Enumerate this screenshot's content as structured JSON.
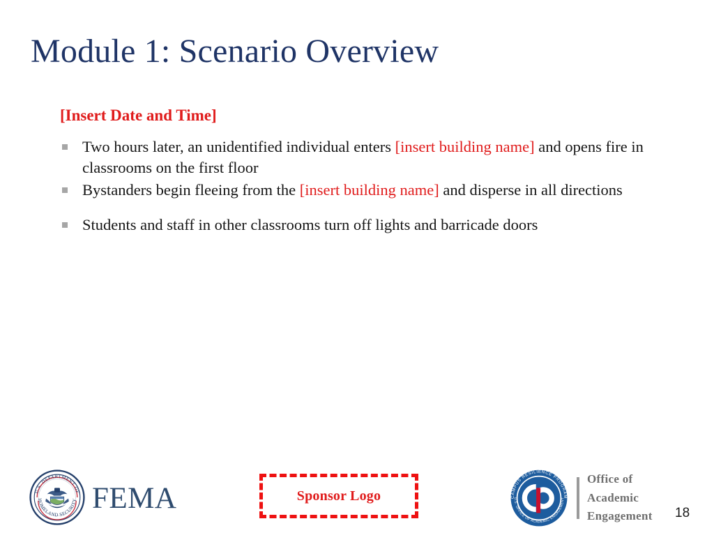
{
  "slide": {
    "title": "Module 1: Scenario Overview",
    "page_number": "18",
    "date_heading": "[Insert Date and Time]",
    "bullets": [
      {
        "parts": [
          {
            "text": "Two hours later, an unidentified individual enters ",
            "color": "black"
          },
          {
            "text": "[insert building name]",
            "color": "red"
          },
          {
            "text": " and opens fire in classrooms on the first floor",
            "color": "black"
          }
        ]
      },
      {
        "parts": [
          {
            "text": "Bystanders begin fleeing from the ",
            "color": "black"
          },
          {
            "text": "[insert building name]",
            "color": "red"
          },
          {
            "text": " and disperse in all directions",
            "color": "black"
          }
        ]
      },
      {
        "spaced": true,
        "parts": [
          {
            "text": "Students and staff in other classrooms turn off lights and barricade doors",
            "color": "black"
          }
        ]
      }
    ]
  },
  "footer": {
    "fema": {
      "seal_icon": "dhs-seal-icon",
      "seal_text_top": "U.S. DEPARTMENT OF",
      "seal_text_bottom": "HOMELAND SECURITY",
      "wordmark": "FEMA"
    },
    "sponsor": {
      "label": "Sponsor Logo"
    },
    "crp": {
      "seal_icon": "campus-resilience-program-seal-icon",
      "seal_monogram": "cp",
      "seal_text_top": "CAMPUS RESILIENCE PROGRAM",
      "seal_text_bottom": "U.S. OFFICE OF ACADEMIC ENGAGEMENT",
      "line1": "Office of",
      "line2": "Academic",
      "line3": "Engagement"
    }
  },
  "colors": {
    "title_navy": "#1F3466",
    "accent_red": "#E01B1B",
    "fema_blue": "#2E4B6E",
    "crp_blue": "#1D5C9E",
    "bullet_gray": "#A6A6A6",
    "text_black": "#141414",
    "background": "#FFFFFF"
  }
}
